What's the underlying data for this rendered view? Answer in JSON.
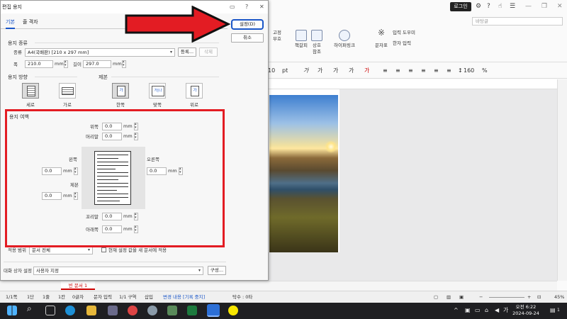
{
  "app": {
    "login_label": "로그인",
    "style_select_placeholder": "바탕글",
    "ribbon": [
      {
        "name": "ribbon-btn-fixed",
        "label": "고정 부호"
      },
      {
        "name": "ribbon-btn-bookmark",
        "label": "책갈피"
      },
      {
        "name": "ribbon-btn-crossref",
        "label": "상호 참조"
      },
      {
        "name": "ribbon-btn-hyperlink",
        "label": "하이퍼링크"
      },
      {
        "name": "ribbon-btn-char-table",
        "label": "문자표"
      },
      {
        "name": "ribbon-btn-input-helper",
        "label": "입력 도우미"
      },
      {
        "name": "ribbon-btn-hanja",
        "label": "한자 입력"
      }
    ],
    "font_size_value": "10",
    "font_size_unit": "pt",
    "zoom_percent": "160",
    "zoom_unit": "%",
    "doc_tab_label": "빈 문서 1",
    "status": {
      "page": "1/1쪽",
      "section_col": "1단",
      "line": "1줄",
      "col": "1칸",
      "chars": "0글자",
      "input_mode": "문자 입력",
      "section": "1/1 구역",
      "insert": "삽입",
      "track": "변경 내용 [기록 중지]",
      "typo": "탁수 : 0타",
      "zoom": "45%"
    }
  },
  "taskbar": {
    "time_period": "오전",
    "time": "6:22",
    "date": "2024-09-24",
    "notification_count": "1"
  },
  "dialog": {
    "title": "편집 용지",
    "tabs": [
      "기본",
      "줄 격자"
    ],
    "ok_button": "설정(D)",
    "cancel_button": "취소",
    "paper_kind": {
      "section_label": "용지 종류",
      "kind_label": "종류",
      "kind_value": "A4(국배판) [210 x 297 mm]",
      "register_button": "등록...",
      "delete_button": "삭제",
      "width_label": "폭",
      "width_value": "210.0",
      "length_label": "길이",
      "length_value": "297.0",
      "unit": "mm"
    },
    "orientation": {
      "section_label": "용지 방향",
      "portrait": "세로",
      "landscape": "가로"
    },
    "binding": {
      "section_label": "제본",
      "one_side": "한쪽",
      "facing": "맞쪽",
      "top": "위로",
      "glyph": "가",
      "glyph_facing": "가|나"
    },
    "margins": {
      "section_label": "용지 여백",
      "top_label": "위쪽",
      "top_value": "0.0",
      "header_label": "머리말",
      "header_value": "0.0",
      "left_label": "왼쪽",
      "left_value": "0.0",
      "right_label": "오른쪽",
      "right_value": "0.0",
      "gutter_label": "제본",
      "gutter_value": "0.0",
      "footer_label": "꼬리말",
      "footer_value": "0.0",
      "bottom_label": "아래쪽",
      "bottom_value": "0.0",
      "unit": "mm"
    },
    "apply_scope_label": "적용 범위",
    "apply_scope_value": "문서 전체",
    "apply_checkbox_label": "현재 설정 값을 새 문서에 적용",
    "dialog_setting_label": "대화 상자 설정",
    "dialog_setting_value": "사용자 지정",
    "config_button": "구성..."
  }
}
